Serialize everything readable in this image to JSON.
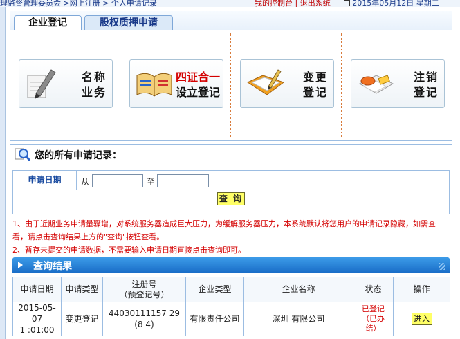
{
  "topbar": {
    "breadcrumb": "理监督管理委员会 >网上注册 > 个人申请记录",
    "account_links": "我的控制台 | 退出系统",
    "date": "2015年05月12日 星期二"
  },
  "tabs": [
    {
      "label": "企业登记"
    },
    {
      "label": "股权质押申请"
    }
  ],
  "services": [
    {
      "icon": "pen-notepad-icon",
      "line1": "名称",
      "line2": "业务"
    },
    {
      "icon": "open-book-icon",
      "line1": "四证合一",
      "line2": "设立登记"
    },
    {
      "icon": "folder-pen-icon",
      "line1": "变更",
      "line2": "登记"
    },
    {
      "icon": "eraser-document-icon",
      "line1": "注销",
      "line2": "登记"
    }
  ],
  "records": {
    "title": "您的所有申请记录：",
    "search": {
      "label": "申请日期",
      "from_label": "从",
      "to_label": "至",
      "from_value": "",
      "to_value": "",
      "query_button": "查 询"
    },
    "notices": [
      "1、由于近期业务申请量骤增，对系统服务器造成巨大压力，为缓解服务器压力，本系统默认将您用户的申请记录隐藏，如需查看，请点击查询结果上方的\"查询\"按钮查看。",
      "2、暂存未提交的申请数据，不需要输入申请日期直接点击查询即可。"
    ]
  },
  "results": {
    "title": "查询结果",
    "columns": {
      "date": "申请日期",
      "type": "申请类型",
      "reg_no_l1": "注册号",
      "reg_no_l2": "（预登记号）",
      "company_type": "企业类型",
      "company_name": "企业名称",
      "status": "状态",
      "action": "操作"
    },
    "rows": [
      {
        "date_l1": "2015-05-07",
        "date_l2": "1 :01:00",
        "type": "变更登记",
        "reg_no_l1": "44030111157 29",
        "reg_no_l2": "(8  4)",
        "company_type": "有限责任公司",
        "company_name": "深圳         有限公司",
        "status_l1": "已登记",
        "status_l2": "（已办",
        "status_l3": "结）",
        "action": "进入"
      }
    ]
  }
}
